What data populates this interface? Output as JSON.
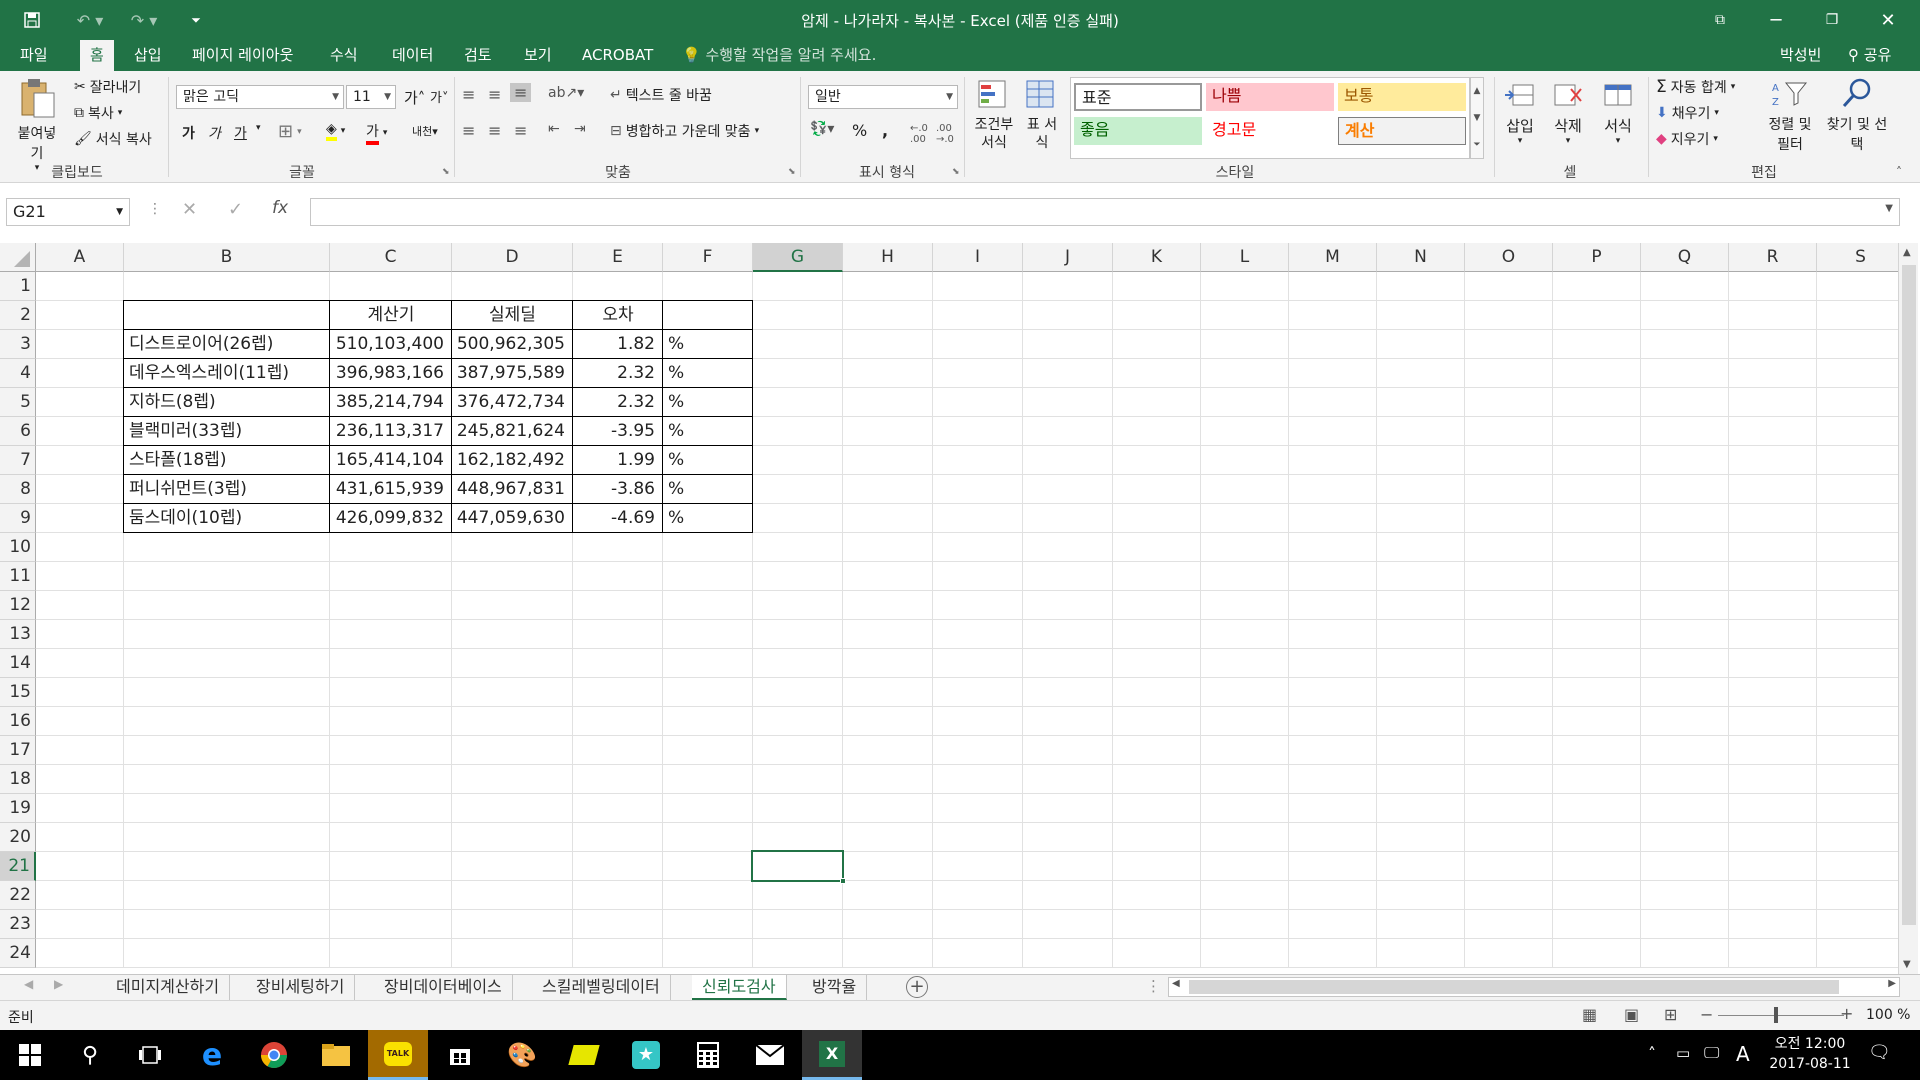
{
  "window": {
    "title": "암제 - 나가라자 - 복사본 - Excel (제품 인증 실패)",
    "user": "박성빈",
    "share": "공유"
  },
  "tabs": [
    "파일",
    "홈",
    "삽입",
    "페이지 레이아웃",
    "수식",
    "데이터",
    "검토",
    "보기",
    "ACROBAT"
  ],
  "tell_me": "수행할 작업을 알려 주세요.",
  "ribbon": {
    "clipboard": {
      "paste": "붙여넣기",
      "cut": "잘라내기",
      "copy": "복사",
      "format_painter": "서식 복사",
      "label": "클립보드"
    },
    "font": {
      "name": "맑은 고딕",
      "size": "11",
      "bold": "가",
      "italic": "가",
      "underline": "가",
      "label": "글꼴"
    },
    "alignment": {
      "wrap": "텍스트 줄 바꿈",
      "merge": "병합하고 가운데 맞춤",
      "label": "맞춤"
    },
    "number": {
      "format": "일반",
      "label": "표시 형식"
    },
    "styles": {
      "conditional": "조건부 서식",
      "table": "표 서식",
      "normal": "표준",
      "bad": "나쁨",
      "neutral": "보통",
      "good": "좋음",
      "warning": "경고문",
      "calc": "계산",
      "label": "스타일"
    },
    "cells": {
      "insert": "삽입",
      "delete": "삭제",
      "format": "서식",
      "label": "셀"
    },
    "editing": {
      "autosum": "자동 합계",
      "fill": "채우기",
      "clear": "지우기",
      "sort": "정렬 및 필터",
      "find": "찾기 및 선택",
      "label": "편집"
    }
  },
  "formula_bar": {
    "name_box": "G21",
    "fx": "fx",
    "formula": ""
  },
  "columns": [
    "A",
    "B",
    "C",
    "D",
    "E",
    "F",
    "G",
    "H",
    "I",
    "J",
    "K",
    "L",
    "M",
    "N",
    "O",
    "P",
    "Q",
    "R",
    "S"
  ],
  "rows": [
    "1",
    "2",
    "3",
    "4",
    "5",
    "6",
    "7",
    "8",
    "9",
    "10",
    "11",
    "12",
    "13",
    "14",
    "15",
    "16",
    "17",
    "18",
    "19",
    "20",
    "21",
    "22",
    "23",
    "24"
  ],
  "table": {
    "headers": [
      "계산기",
      "실제딜",
      "오차"
    ],
    "rows": [
      {
        "name": "디스트로이어(26렙)",
        "calc": "510,103,400",
        "actual": "500,962,305",
        "err": "1.82",
        "unit": "%"
      },
      {
        "name": "데우스엑스레이(11렙)",
        "calc": "396,983,166",
        "actual": "387,975,589",
        "err": "2.32",
        "unit": "%"
      },
      {
        "name": "지하드(8렙)",
        "calc": "385,214,794",
        "actual": "376,472,734",
        "err": "2.32",
        "unit": "%"
      },
      {
        "name": "블랙미러(33렙)",
        "calc": "236,113,317",
        "actual": "245,821,624",
        "err": "-3.95",
        "unit": "%"
      },
      {
        "name": "스타폴(18렙)",
        "calc": "165,414,104",
        "actual": "162,182,492",
        "err": "1.99",
        "unit": "%"
      },
      {
        "name": "퍼니쉬먼트(3렙)",
        "calc": "431,615,939",
        "actual": "448,967,831",
        "err": "-3.86",
        "unit": "%"
      },
      {
        "name": "둠스데이(10렙)",
        "calc": "426,099,832",
        "actual": "447,059,630",
        "err": "-4.69",
        "unit": "%"
      }
    ]
  },
  "sheets": [
    "데미지계산하기",
    "장비세팅하기",
    "장비데이터베이스",
    "스킬레벨링데이터",
    "신뢰도검사",
    "방깍율"
  ],
  "active_sheet": "신뢰도검사",
  "status": {
    "mode": "준비",
    "zoom": "100 %"
  },
  "taskbar": {
    "time": "오전 12:00",
    "date": "2017-08-11",
    "ime": "A"
  },
  "colors": {
    "excel_green": "#217346"
  }
}
